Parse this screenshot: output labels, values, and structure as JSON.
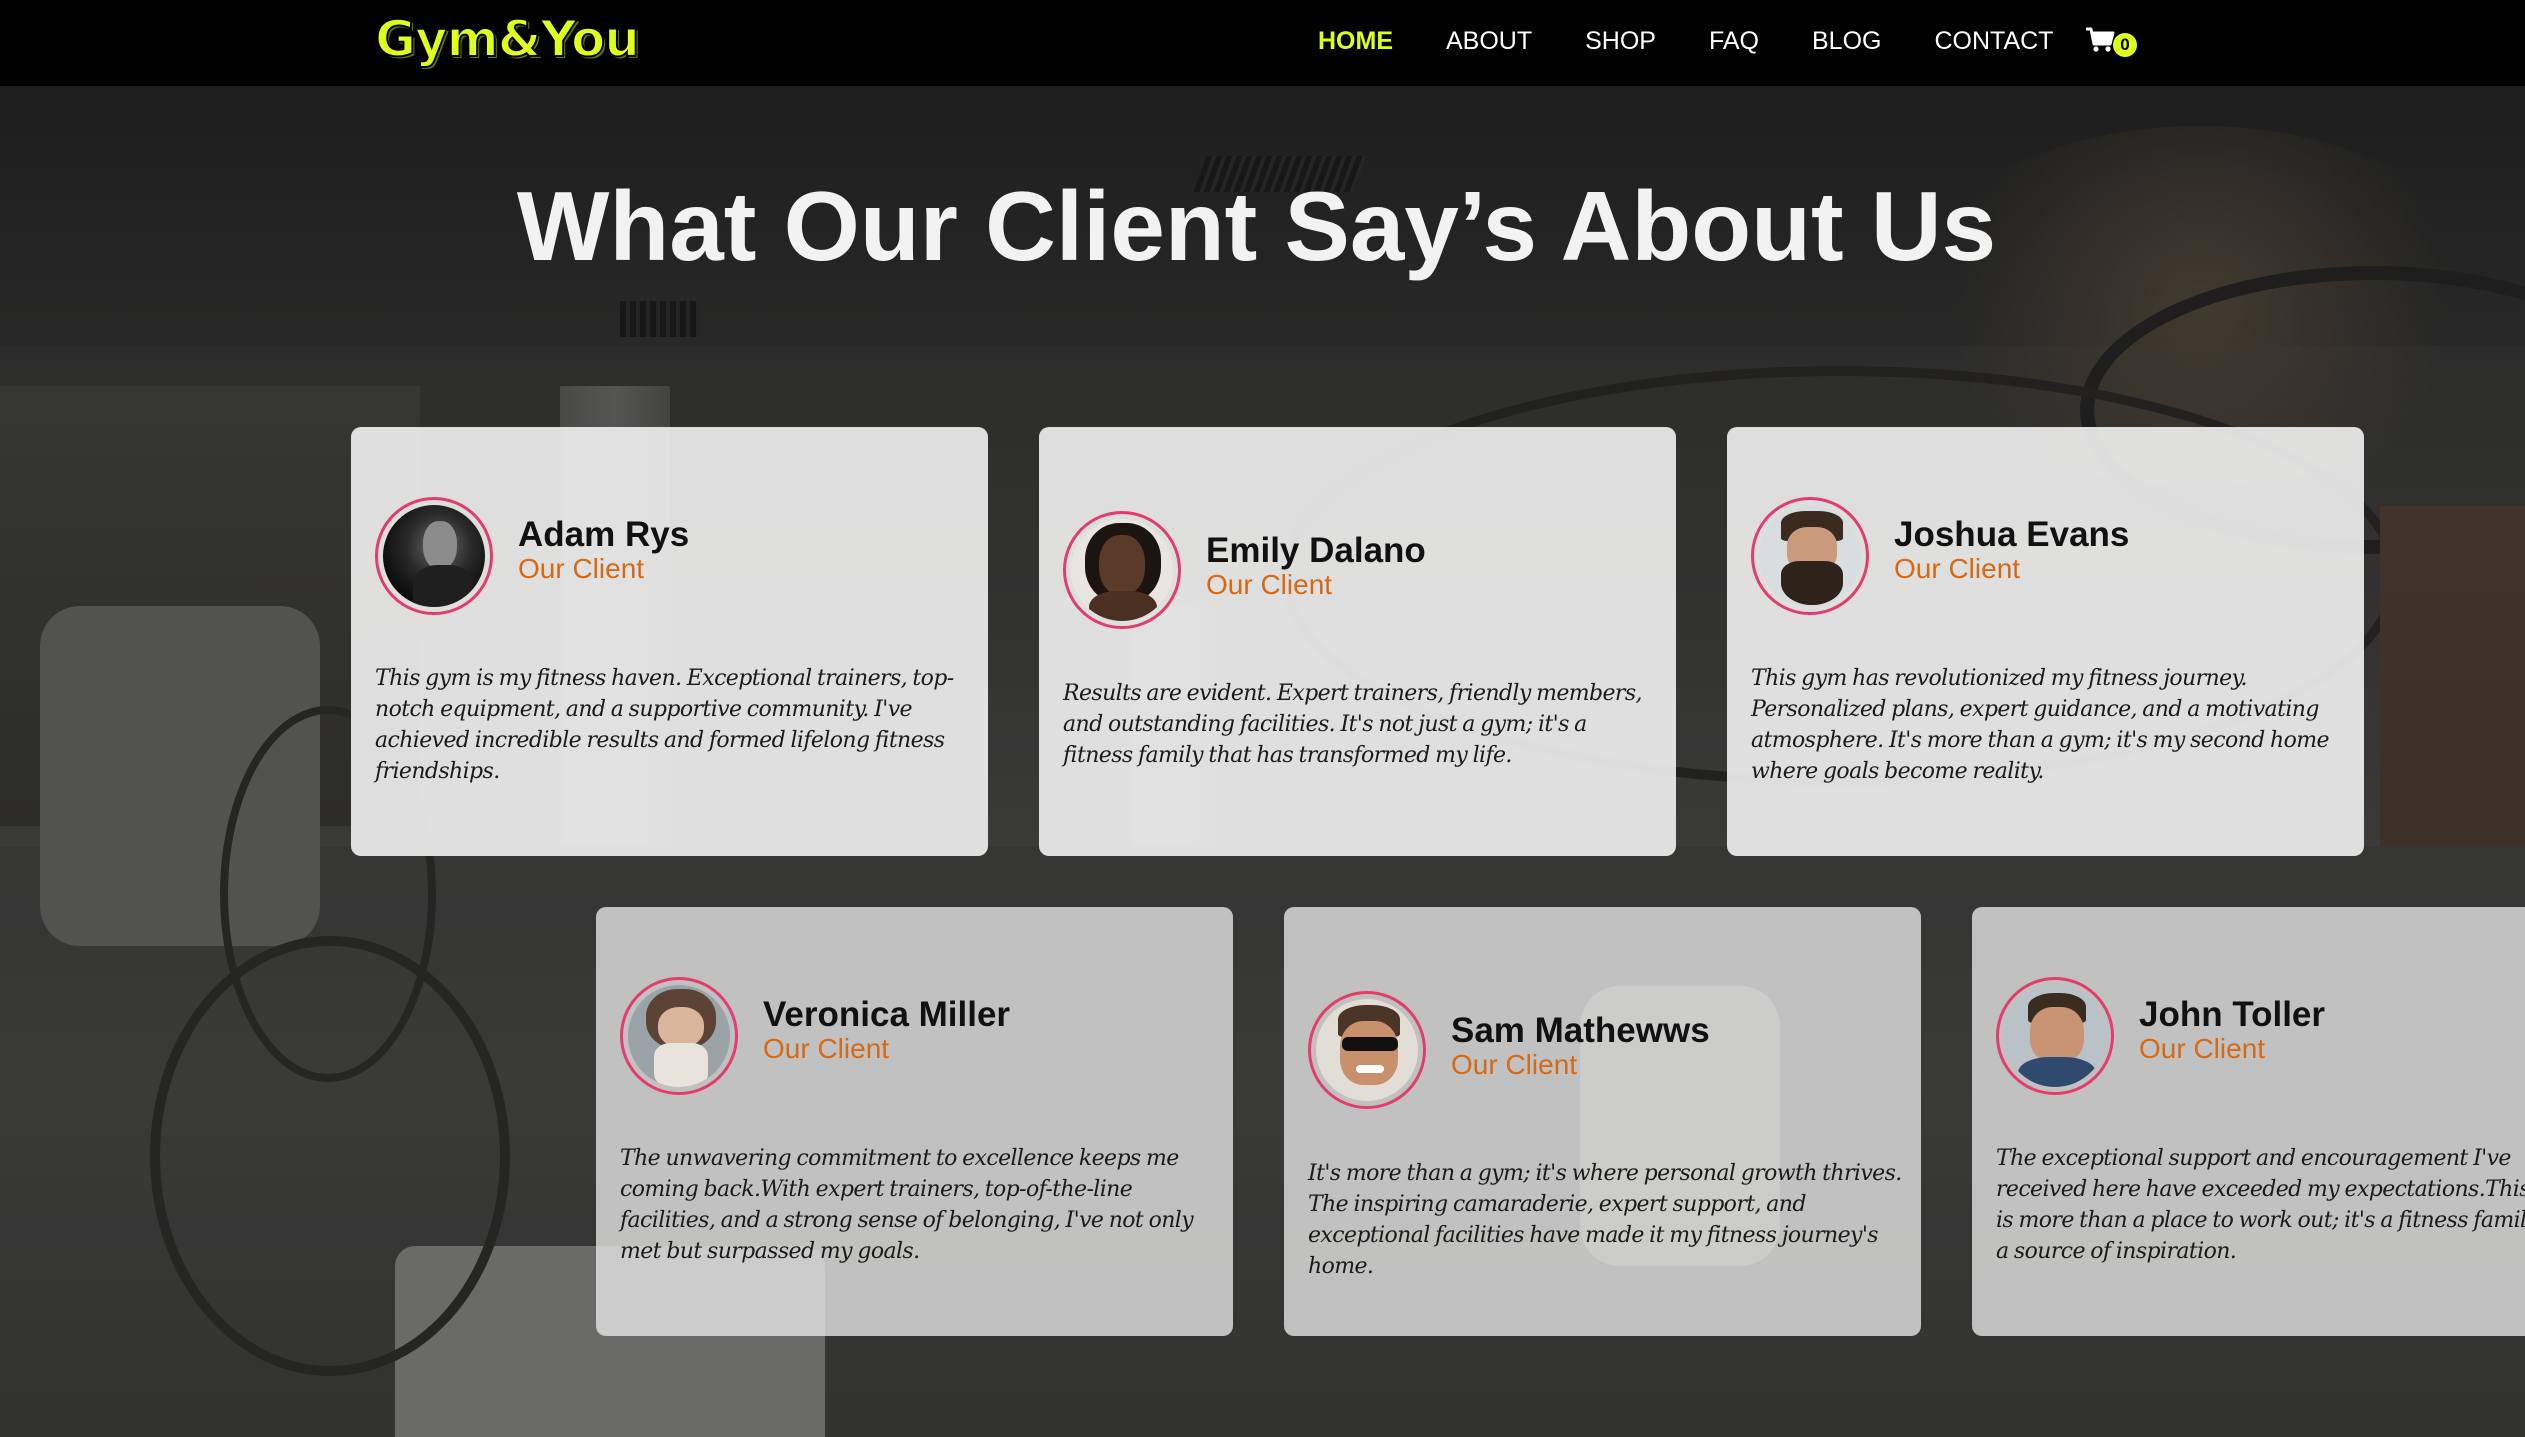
{
  "nav": {
    "logo": "Gym&You",
    "items": [
      {
        "label": "HOME",
        "active": true
      },
      {
        "label": "ABOUT",
        "active": false
      },
      {
        "label": "SHOP",
        "active": false
      },
      {
        "label": "FAQ",
        "active": false
      },
      {
        "label": "BLOG",
        "active": false
      },
      {
        "label": "CONTACT",
        "active": false
      }
    ],
    "cart_count": "0",
    "cart_icon": "shopping-cart-icon"
  },
  "heading": "What Our Client Say’s About Us",
  "testimonials": [
    {
      "name": "Adam Rys",
      "role": "Our Client",
      "quote": "This gym is my fitness haven. Exceptional trainers, top-notch equipment, and a supportive community. I've achieved incredible results and formed lifelong fitness friendships."
    },
    {
      "name": "Emily Dalano",
      "role": "Our Client",
      "quote": "Results are evident. Expert trainers, friendly members, and outstanding facilities. It's not just a gym; it's a fitness family that has transformed my life."
    },
    {
      "name": "Joshua Evans",
      "role": "Our Client",
      "quote": "This gym has revolutionized my fitness journey. Personalized plans, expert guidance, and a motivating atmosphere. It's more than a gym; it's my second home where goals become reality."
    },
    {
      "name": "Veronica Miller",
      "role": "Our Client",
      "quote": "The unwavering commitment to excellence keeps me coming back.With expert trainers, top-of-the-line facilities, and a strong sense of belonging, I've not only met but surpassed my goals."
    },
    {
      "name": "Sam Mathewws",
      "role": "Our Client",
      "quote": "It's more than a gym; it's where personal growth thrives. The inspiring camaraderie, expert support, and exceptional facilities have made it my fitness journey's home."
    },
    {
      "name": "John Toller",
      "role": "Our Client",
      "quote": "The exceptional support and encouragement I've received here have exceeded my expectations.This gym is more than a place to work out; it's a fitness family and a source of inspiration."
    }
  ],
  "colors": {
    "accent": "#e0ff1a",
    "role": "#d66a14",
    "avatar_ring": "#e23d6d",
    "nav_bg": "#000000"
  }
}
